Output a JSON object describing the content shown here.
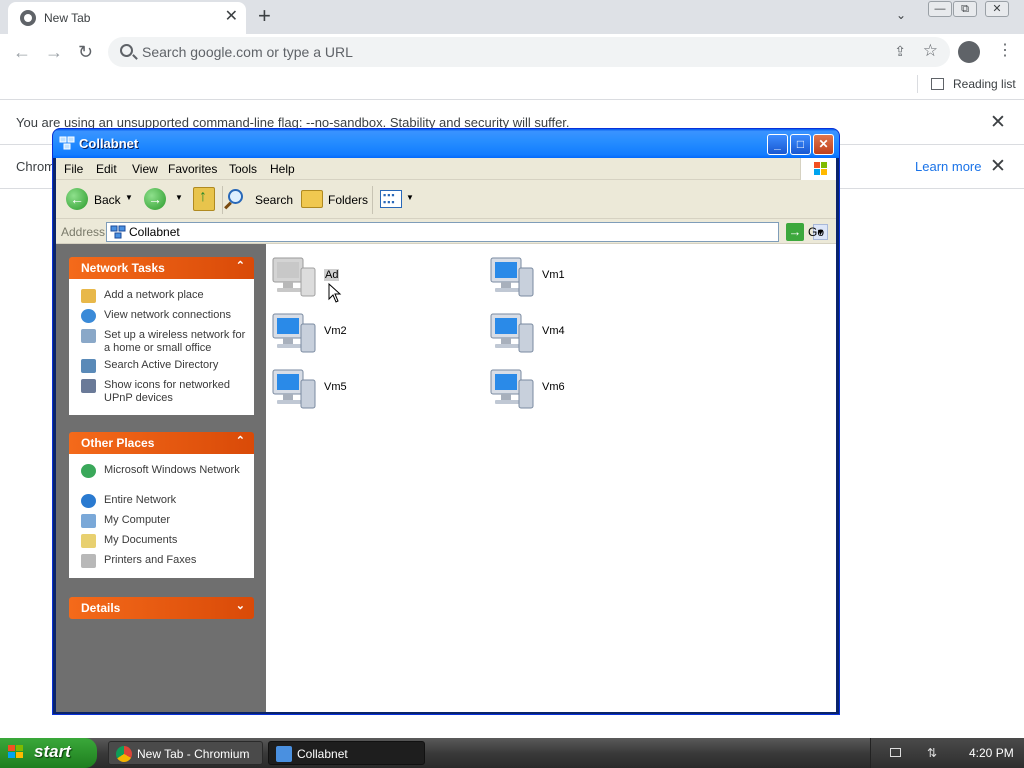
{
  "browser": {
    "tab_title": "New Tab",
    "tab_close": "✕",
    "new_tab": "+",
    "tab_search": "⌄",
    "nav_back": "←",
    "nav_forward": "→",
    "nav_reload": "↻",
    "omnibox_placeholder": "Search google.com or type a URL",
    "share_glyph": "⇪",
    "star_glyph": "☆",
    "menu_glyph": "⋮",
    "reading_list": "Reading list",
    "win_controls": [
      "—",
      "⧉",
      "✕"
    ]
  },
  "infobars": [
    {
      "text": "You are using an unsupported command-line flag: --no-sandbox. Stability and security will suffer.",
      "close": "✕"
    },
    {
      "text": "Chromi",
      "link": "Learn more",
      "close": "✕"
    }
  ],
  "explorer": {
    "title": "Collabnet",
    "title_buttons": {
      "minimize": "_",
      "maximize": "□",
      "close": "✕"
    },
    "menu": [
      "File",
      "Edit",
      "View",
      "Favorites",
      "Tools",
      "Help"
    ],
    "toolbar": {
      "back": "Back",
      "search": "Search",
      "folders": "Folders"
    },
    "address_label": "Address",
    "address_value": "Collabnet",
    "go": "Go",
    "panels": [
      {
        "title": "Network Tasks",
        "items": [
          "Add a network place",
          "View network connections",
          "Set up a wireless network for a home or small office",
          "Search Active Directory",
          "Show icons for networked UPnP devices"
        ]
      },
      {
        "title": "Other Places",
        "items": [
          "Microsoft Windows Network",
          "Entire Network",
          "My Computer",
          "My Documents",
          "Printers and Faxes"
        ]
      },
      {
        "title": "Details",
        "items": []
      }
    ],
    "computers": [
      "Ad",
      "Vm1",
      "Vm2",
      "Vm4",
      "Vm5",
      "Vm6"
    ],
    "selected": "Ad"
  },
  "taskbar": {
    "start": "start",
    "tasks": [
      "New Tab - Chromium",
      "Collabnet"
    ],
    "clock": "4:20 PM"
  },
  "colors": {
    "xp_title_blue": "#127dff",
    "panel_orange": "#f46a1a",
    "start_green": "#2a9a2a",
    "link_blue": "#1a73e8"
  }
}
